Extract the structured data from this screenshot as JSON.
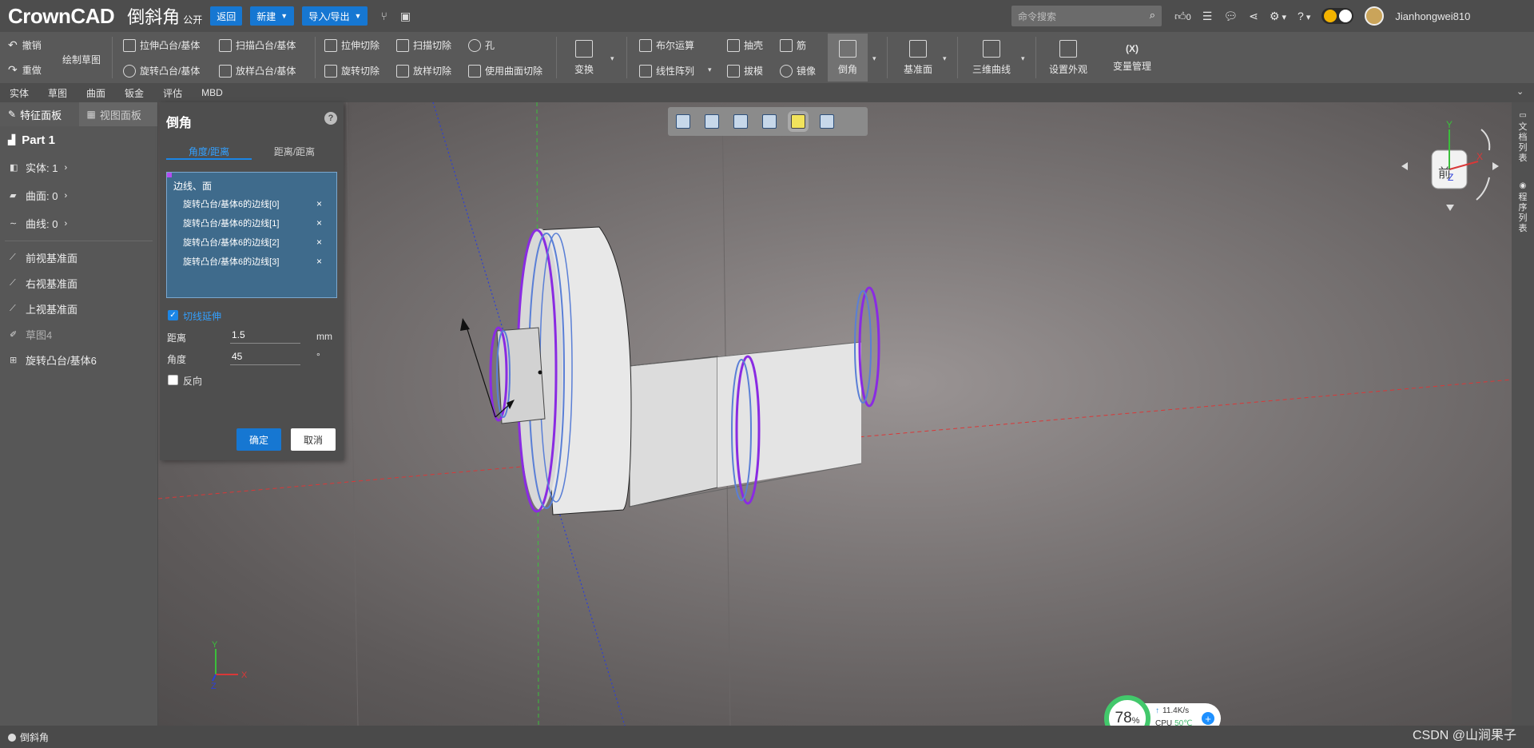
{
  "topbar": {
    "logo": "CrownCAD",
    "doc_title": "倒斜角",
    "doc_badge": "公开",
    "back_label": "返回",
    "new_label": "新建",
    "import_export_label": "导入/导出",
    "search_placeholder": "命令搜索",
    "likes": "0",
    "username": "Jianhongwei810"
  },
  "ribbon": {
    "undo": "撤销",
    "redo": "重做",
    "sketch": "绘制草图",
    "extrude_boss": "拉伸凸台/基体",
    "sweep_boss": "扫描凸台/基体",
    "extrude_cut": "拉伸切除",
    "sweep_cut": "扫描切除",
    "hole": "孔",
    "revolve_boss": "旋转凸台/基体",
    "loft_boss": "放样凸台/基体",
    "revolve_cut": "旋转切除",
    "loft_cut": "放样切除",
    "surface_cut": "使用曲面切除",
    "transform": "变换",
    "boolean": "布尔运算",
    "shell": "抽壳",
    "rib": "筋",
    "linear_pattern": "线性阵列",
    "draft": "拔模",
    "mirror": "镜像",
    "chamfer": "倒角",
    "ref_plane": "基准面",
    "curve_3d": "三维曲线",
    "appearance": "设置外观",
    "variables_icon": "(X)",
    "variables": "变量管理"
  },
  "tabs": [
    "实体",
    "草图",
    "曲面",
    "钣金",
    "评估",
    "MBD"
  ],
  "left_panel": {
    "tab_feature": "特征面板",
    "tab_view": "视图面板",
    "part": "Part 1",
    "solids": "实体: 1",
    "surfaces": "曲面: 0",
    "curves": "曲线: 0",
    "front_plane": "前视基准面",
    "right_plane": "右视基准面",
    "top_plane": "上视基准面",
    "sketch4": "草图4",
    "revolve6": "旋转凸台/基体6"
  },
  "dialog": {
    "title": "倒角",
    "help": "?",
    "tab_angle_distance": "角度/距离",
    "tab_distance_distance": "距离/距离",
    "selection_header": "边线、面",
    "selections": [
      "旋转凸台/基体6的边线[0]",
      "旋转凸台/基体6的边线[1]",
      "旋转凸台/基体6的边线[2]",
      "旋转凸台/基体6的边线[3]"
    ],
    "remove_mark": "×",
    "tangent_label": "切线延伸",
    "distance_label": "距离",
    "distance_value": "1.5",
    "distance_unit": "mm",
    "angle_label": "角度",
    "angle_value": "45",
    "angle_unit": "°",
    "reverse_label": "反向",
    "ok": "确定",
    "cancel": "取消"
  },
  "viewport": {
    "nav_front_label": "前",
    "axis_y": "Y",
    "axis_x": "X",
    "axis_z": "Z"
  },
  "right_rail": {
    "doc_list": "文档列表",
    "program_list": "程序列表"
  },
  "status": {
    "current_feature": "倒斜角",
    "watermark": "CSDN @山涧果子"
  },
  "perf": {
    "memory_percent": "78",
    "percent_sign": "%",
    "upload_speed": "11.4K/s",
    "cpu_label": "CPU",
    "cpu_temp": "50℃"
  },
  "colors": {
    "accent_blue": "#1677d2",
    "selection_purple": "#8a2be2",
    "edge_blue": "#5a7fd6"
  }
}
